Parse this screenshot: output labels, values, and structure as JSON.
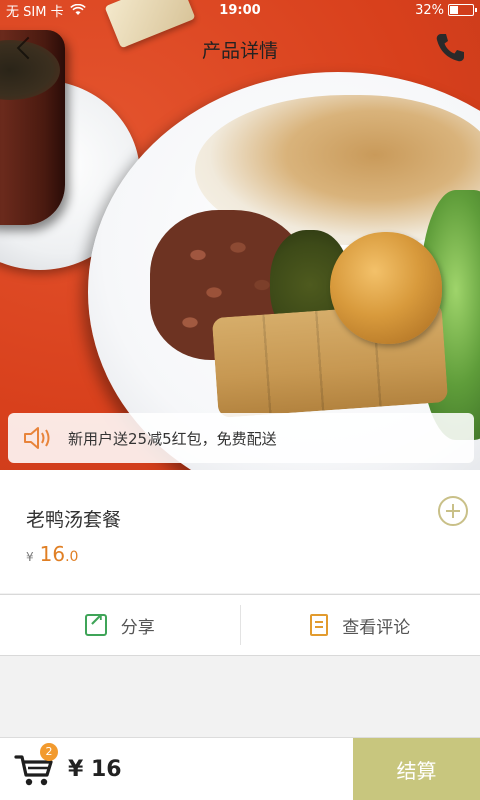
{
  "status_bar": {
    "carrier": "无 SIM 卡",
    "time": "19:00",
    "battery": "32%",
    "battery_level": 0.32,
    "icons": [
      "wifi-icon",
      "battery-icon"
    ]
  },
  "nav": {
    "title": "产品详情",
    "icons": [
      "back-icon",
      "phone-icon"
    ]
  },
  "promo": {
    "text": "新用户送25减5红包，免费配送",
    "icon": "speaker-icon"
  },
  "product": {
    "name": "老鸭汤套餐",
    "currency": "¥",
    "price_int": "16",
    "price_dec": ".0",
    "add_icon": "plus-circle-icon"
  },
  "actions": [
    {
      "label": "分享",
      "icon": "share-icon"
    },
    {
      "label": "查看评论",
      "icon": "review-icon"
    }
  ],
  "bottom_bar": {
    "cart_count": "2",
    "total": "¥ 16",
    "checkout_label": "结算"
  },
  "colors": {
    "accent": "#c8c67e",
    "price": "#e07f24",
    "badge": "#f29a2e",
    "share": "#3fa458",
    "review": "#e29b2e"
  }
}
